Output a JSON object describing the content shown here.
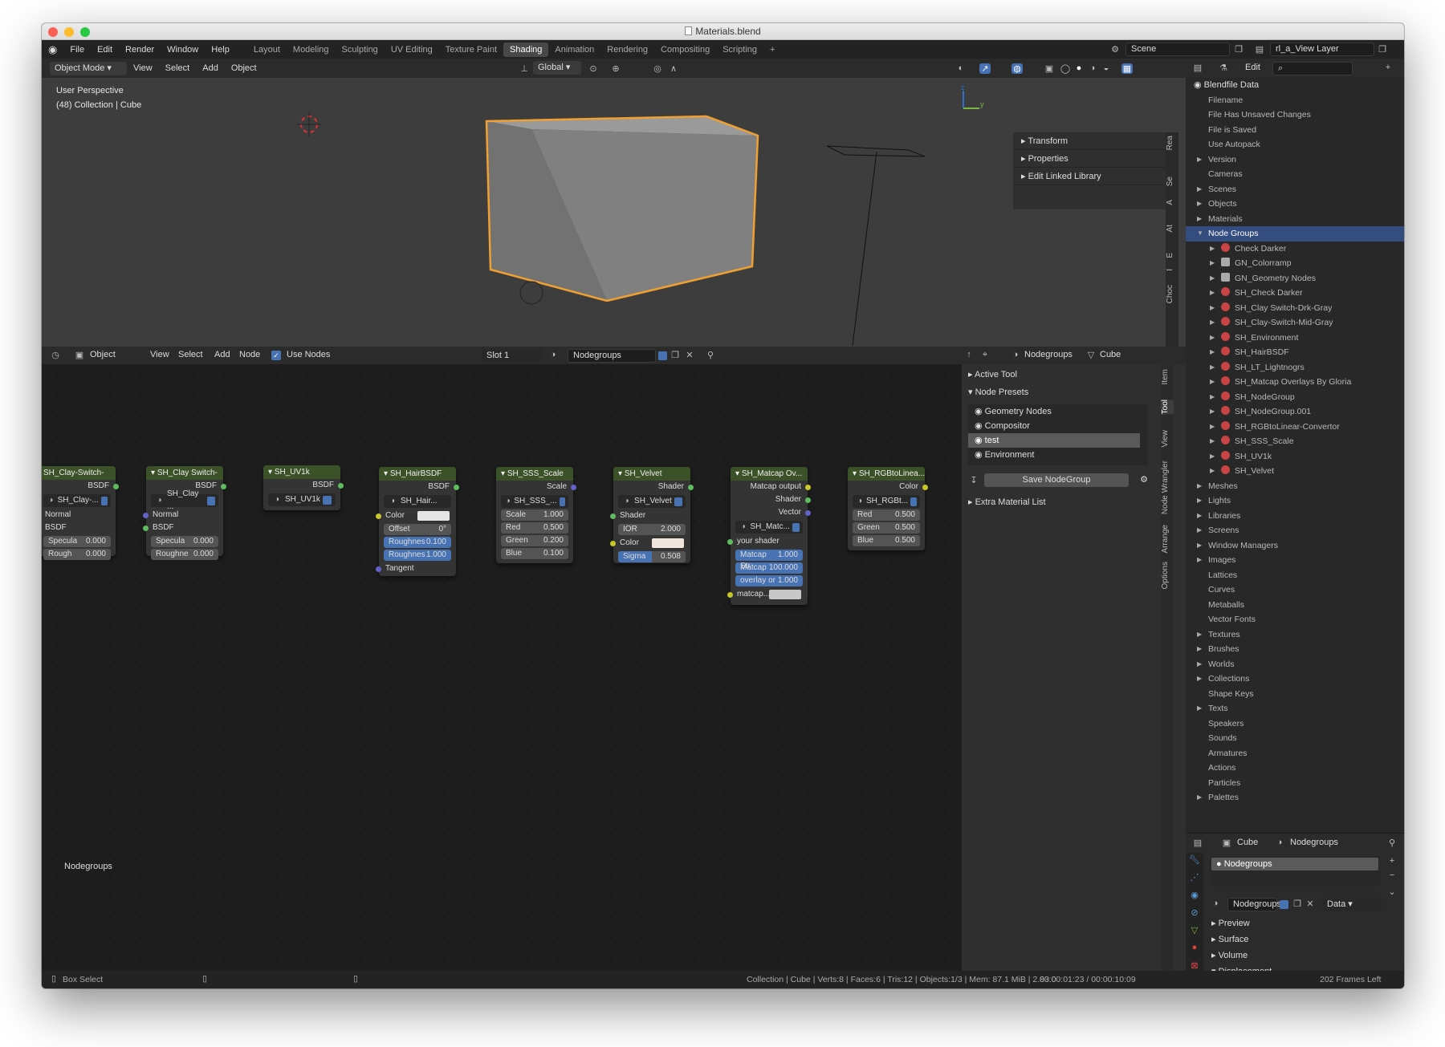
{
  "window": {
    "title": "Materials.blend"
  },
  "topbar": {
    "menus": [
      "File",
      "Edit",
      "Render",
      "Window",
      "Help"
    ],
    "workspaces": [
      "Layout",
      "Modeling",
      "Sculpting",
      "UV Editing",
      "Texture Paint",
      "Shading",
      "Animation",
      "Rendering",
      "Compositing",
      "Scripting"
    ],
    "active_workspace": "Shading",
    "add_tab": "+",
    "scene": "Scene",
    "view_layer": "rl_a_View Layer"
  },
  "viewport_header": {
    "mode": "Object Mode",
    "menus": [
      "View",
      "Select",
      "Add",
      "Object"
    ],
    "orientation": "Global"
  },
  "viewport": {
    "perspective": "User Perspective",
    "collection": "(48) Collection | Cube",
    "npanel": [
      "Transform",
      "Properties",
      "Edit Linked Library"
    ],
    "side_tabs": [
      "Rea",
      "Se",
      "A",
      "At",
      "E",
      "I",
      "Choc"
    ],
    "axis_z": "z",
    "axis_y": "y"
  },
  "node_header": {
    "type": "Object",
    "menus": [
      "View",
      "Select",
      "Add",
      "Node"
    ],
    "use_nodes_label": "Use Nodes",
    "use_nodes": true,
    "slot": "Slot 1",
    "material": "Nodegroups",
    "breadcrumb_material": "Nodegroups",
    "breadcrumb_object": "Cube"
  },
  "node_editor": {
    "label": "Nodegroups",
    "nodes": [
      {
        "title": "SH_Clay-Switch-",
        "out": "BSDF",
        "sel": "SH_Clay-...",
        "rows": [
          [
            "Normal",
            ""
          ],
          [
            "BSDF",
            ""
          ]
        ],
        "fields": [
          [
            "Specula",
            "0.000"
          ],
          [
            "Rough",
            "0.000"
          ]
        ]
      },
      {
        "title": "SH_Clay Switch-",
        "out": "BSDF",
        "sel": "SH_Clay ...",
        "rows": [
          [
            "Normal",
            ""
          ],
          [
            "BSDF",
            ""
          ]
        ],
        "fields": [
          [
            "Specula",
            "0.000"
          ],
          [
            "Roughne",
            "0.000"
          ]
        ]
      },
      {
        "title": "SH_UV1k",
        "out": "BSDF",
        "sel": "SH_UV1k",
        "rows": [],
        "fields": []
      },
      {
        "title": "SH_HairBSDF",
        "out": "BSDF",
        "sel": "SH_Hair...",
        "color": "Color",
        "fields": [
          [
            "Offset",
            "0°"
          ],
          [
            "Roughnes",
            "0.100"
          ],
          [
            "Roughnes",
            "1.000"
          ]
        ],
        "tangent": "Tangent"
      },
      {
        "title": "SH_SSS_Scale",
        "out": "Scale",
        "sel": "SH_SSS_...",
        "fields": [
          [
            "Scale",
            "1.000"
          ],
          [
            "Red",
            "0.500"
          ],
          [
            "Green",
            "0.200"
          ],
          [
            "Blue",
            "0.100"
          ]
        ]
      },
      {
        "title": "SH_Velvet",
        "out": "Shader",
        "sel": "SH_Velvet",
        "shader": "Shader",
        "fields": [
          [
            "IOR",
            "2.000"
          ]
        ],
        "color": "Color",
        "sigma": [
          "Sigma",
          "0.508"
        ]
      },
      {
        "title": "SH_Matcap Ov...",
        "outs": [
          "Matcap output",
          "Shader",
          "Vector"
        ],
        "sel": "SH_Matc...",
        "input": "your shader",
        "fields": [
          [
            "Matcap Str",
            "1.000"
          ],
          [
            "Matcap",
            "100.000"
          ],
          [
            "overlay or",
            "1.000"
          ]
        ],
        "last": "matcap..."
      },
      {
        "title": "SH_RGBtoLinea...",
        "out": "Color",
        "sel": "SH_RGBt...",
        "fields": [
          [
            "Red",
            "0.500"
          ],
          [
            "Green",
            "0.500"
          ],
          [
            "Blue",
            "0.500"
          ]
        ]
      }
    ]
  },
  "tool_panel": {
    "active_tool": "Active Tool",
    "node_presets": "Node Presets",
    "presets": [
      "Geometry Nodes",
      "Compositor",
      "test",
      "Environment"
    ],
    "selected_preset": "test",
    "save_button": "Save NodeGroup",
    "extra": "Extra Material List",
    "tabs": [
      "Item",
      "Tool",
      "View",
      "Node Wrangler",
      "Arrange",
      "Options"
    ]
  },
  "outliner": {
    "edit": "Edit",
    "root": "Blendfile Data",
    "rows": [
      {
        "label": "Filename",
        "exp": false,
        "indent": 1,
        "tri": false
      },
      {
        "label": "File Has Unsaved Changes",
        "indent": 1,
        "tri": false
      },
      {
        "label": "File is Saved",
        "indent": 1,
        "tri": false
      },
      {
        "label": "Use Autopack",
        "indent": 1,
        "tri": false
      },
      {
        "label": "Version",
        "indent": 1,
        "tri": true
      },
      {
        "label": "Cameras",
        "indent": 1,
        "tri": false
      },
      {
        "label": "Scenes",
        "indent": 1,
        "tri": true
      },
      {
        "label": "Objects",
        "indent": 1,
        "tri": true
      },
      {
        "label": "Materials",
        "indent": 1,
        "tri": true
      },
      {
        "label": "Node Groups",
        "indent": 1,
        "tri": true,
        "open": true,
        "sel": true
      },
      {
        "label": "Check Darker",
        "indent": 2,
        "tri": true,
        "icon": "red"
      },
      {
        "label": "GN_Colorramp",
        "indent": 2,
        "tri": true,
        "icon": "gray"
      },
      {
        "label": "GN_Geometry Nodes",
        "indent": 2,
        "tri": true,
        "icon": "gray"
      },
      {
        "label": "SH_Check Darker",
        "indent": 2,
        "tri": true,
        "icon": "red"
      },
      {
        "label": "SH_Clay Switch-Drk-Gray",
        "indent": 2,
        "tri": true,
        "icon": "red"
      },
      {
        "label": "SH_Clay-Switch-Mid-Gray",
        "indent": 2,
        "tri": true,
        "icon": "red"
      },
      {
        "label": "SH_Environment",
        "indent": 2,
        "tri": true,
        "icon": "red"
      },
      {
        "label": "SH_HairBSDF",
        "indent": 2,
        "tri": true,
        "icon": "red"
      },
      {
        "label": "SH_LT_Lightnogrs",
        "indent": 2,
        "tri": true,
        "icon": "red"
      },
      {
        "label": "SH_Matcap Overlays By Gloria",
        "indent": 2,
        "tri": true,
        "icon": "red"
      },
      {
        "label": "SH_NodeGroup",
        "indent": 2,
        "tri": true,
        "icon": "red"
      },
      {
        "label": "SH_NodeGroup.001",
        "indent": 2,
        "tri": true,
        "icon": "red"
      },
      {
        "label": "SH_RGBtoLinear-Convertor",
        "indent": 2,
        "tri": true,
        "icon": "red"
      },
      {
        "label": "SH_SSS_Scale",
        "indent": 2,
        "tri": true,
        "icon": "red"
      },
      {
        "label": "SH_UV1k",
        "indent": 2,
        "tri": true,
        "icon": "red"
      },
      {
        "label": "SH_Velvet",
        "indent": 2,
        "tri": true,
        "icon": "red"
      },
      {
        "label": "Meshes",
        "indent": 1,
        "tri": true
      },
      {
        "label": "Lights",
        "indent": 1,
        "tri": true
      },
      {
        "label": "Libraries",
        "indent": 1,
        "tri": true
      },
      {
        "label": "Screens",
        "indent": 1,
        "tri": true
      },
      {
        "label": "Window Managers",
        "indent": 1,
        "tri": true
      },
      {
        "label": "Images",
        "indent": 1,
        "tri": true
      },
      {
        "label": "Lattices",
        "indent": 1,
        "tri": false
      },
      {
        "label": "Curves",
        "indent": 1,
        "tri": false
      },
      {
        "label": "Metaballs",
        "indent": 1,
        "tri": false
      },
      {
        "label": "Vector Fonts",
        "indent": 1,
        "tri": false
      },
      {
        "label": "Textures",
        "indent": 1,
        "tri": true
      },
      {
        "label": "Brushes",
        "indent": 1,
        "tri": true
      },
      {
        "label": "Worlds",
        "indent": 1,
        "tri": true
      },
      {
        "label": "Collections",
        "indent": 1,
        "tri": true
      },
      {
        "label": "Shape Keys",
        "indent": 1,
        "tri": false
      },
      {
        "label": "Texts",
        "indent": 1,
        "tri": true
      },
      {
        "label": "Speakers",
        "indent": 1,
        "tri": false
      },
      {
        "label": "Sounds",
        "indent": 1,
        "tri": false
      },
      {
        "label": "Armatures",
        "indent": 1,
        "tri": false
      },
      {
        "label": "Actions",
        "indent": 1,
        "tri": false
      },
      {
        "label": "Particles",
        "indent": 1,
        "tri": false
      },
      {
        "label": "Palettes",
        "indent": 1,
        "tri": true
      }
    ]
  },
  "properties": {
    "object": "Cube",
    "material": "Nodegroups",
    "slot_item": "Nodegroups",
    "mat_field": "Nodegroups",
    "data": "Data",
    "sections": [
      "Preview",
      "Surface",
      "Volume",
      "Displacement"
    ]
  },
  "statusbar": {
    "tool": "Box Select",
    "stats": "Collection | Cube | Verts:8 | Faces:6 | Tris:12 | Objects:1/3 | Mem: 87.1 MiB | 2.83.0",
    "time": "00:00:01:23 / 00:00:10:09",
    "frames": "202 Frames Left"
  },
  "colors": {
    "accent": "#4772b3",
    "selection": "#f0a030",
    "node_header": "#3b5228"
  }
}
